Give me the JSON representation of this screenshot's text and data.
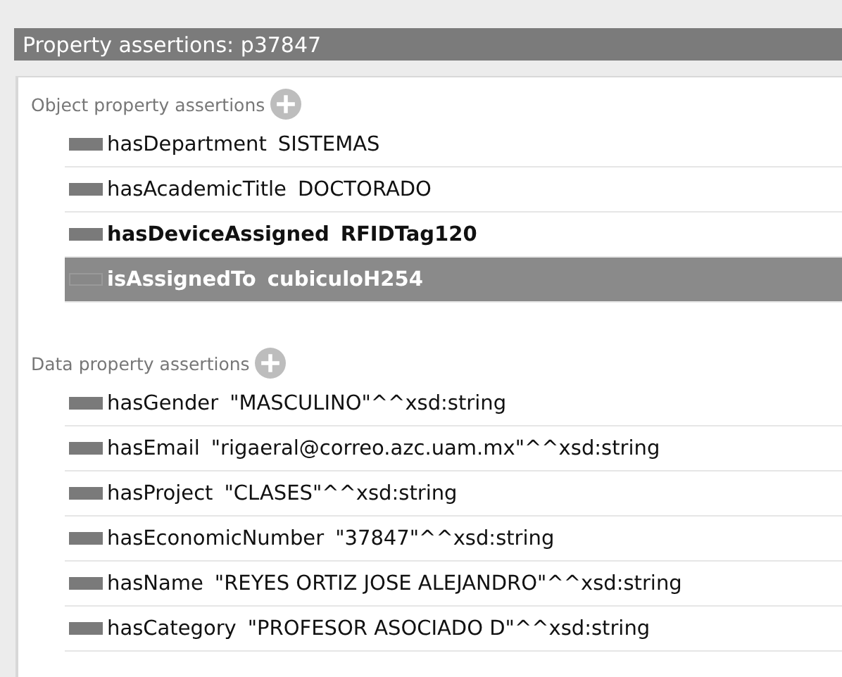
{
  "header": {
    "title": "Property assertions: p37847"
  },
  "sections": [
    {
      "title": "Object property assertions",
      "rows": [
        {
          "property": "hasDepartment",
          "value": "SISTEMAS",
          "bold": false,
          "selected": false
        },
        {
          "property": "hasAcademicTitle",
          "value": "DOCTORADO",
          "bold": false,
          "selected": false
        },
        {
          "property": "hasDeviceAssigned",
          "value": "RFIDTag120",
          "bold": true,
          "selected": false
        },
        {
          "property": "isAssignedTo",
          "value": "cubiculoH254",
          "bold": true,
          "selected": true
        }
      ]
    },
    {
      "title": "Data property assertions",
      "rows": [
        {
          "property": "hasGender",
          "value": "\"MASCULINO\"^^xsd:string",
          "bold": false,
          "selected": false
        },
        {
          "property": "hasEmail",
          "value": "\"rigaeral@correo.azc.uam.mx\"^^xsd:string",
          "bold": false,
          "selected": false
        },
        {
          "property": "hasProject",
          "value": "\"CLASES\"^^xsd:string",
          "bold": false,
          "selected": false
        },
        {
          "property": "hasEconomicNumber",
          "value": "\"37847\"^^xsd:string",
          "bold": false,
          "selected": false
        },
        {
          "property": "hasName",
          "value": "\"REYES ORTIZ JOSE ALEJANDRO\"^^xsd:string",
          "bold": false,
          "selected": false
        },
        {
          "property": "hasCategory",
          "value": "\"PROFESOR ASOCIADO D\"^^xsd:string",
          "bold": false,
          "selected": false
        }
      ]
    }
  ]
}
